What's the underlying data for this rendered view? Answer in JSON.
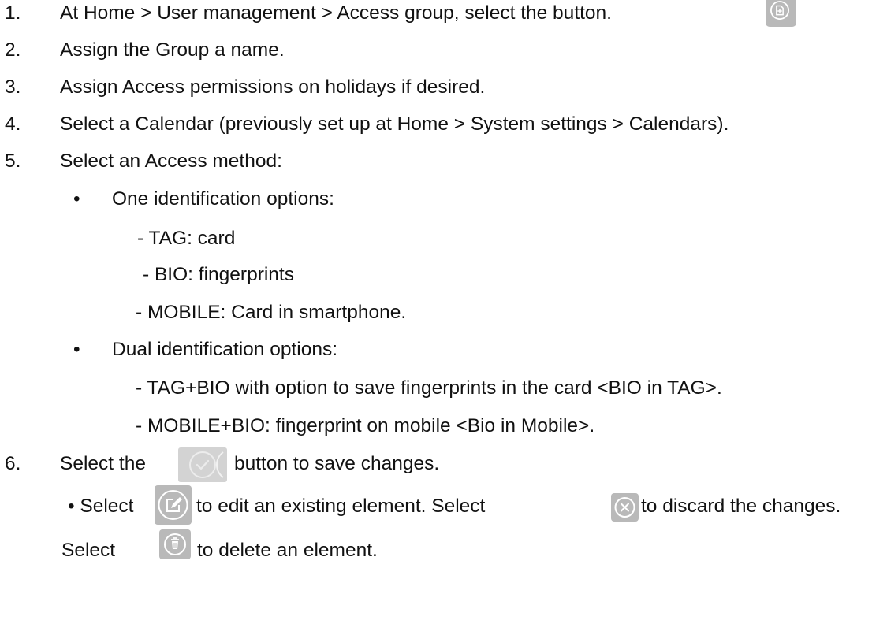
{
  "steps": [
    {
      "num": "1.",
      "text": "At Home > User management > Access group, select the button."
    },
    {
      "num": "2.",
      "text": "Assign the Group a name."
    },
    {
      "num": "3.",
      "text": "Assign Access permissions on holidays if desired."
    },
    {
      "num": "4.",
      "text": "Select a Calendar (previously set up at Home > System settings > Calendars)."
    },
    {
      "num": "5.",
      "text": "Select an Access method:"
    },
    {
      "num": "6.",
      "text_before": "Select the",
      "text_after": "button to save changes."
    }
  ],
  "access_methods": {
    "one": {
      "bullet": "•",
      "label": "One identification options:",
      "items": [
        "- TAG: card",
        "- BIO: fingerprints",
        "- MOBILE: Card in smartphone."
      ]
    },
    "dual": {
      "bullet": "•",
      "label": "Dual identification options:",
      "items": [
        "- TAG+BIO with option to save fingerprints in the card <BIO in TAG>.",
        "- MOBILE+BIO: fingerprint on mobile <Bio in Mobile>."
      ]
    }
  },
  "notes": {
    "edit_prefix": "• Select",
    "edit_text": "to edit an existing element. Select",
    "discard_text": "to discard the changes.",
    "delete_prefix": "Select",
    "delete_text": "to delete an element."
  },
  "icons": {
    "add": "add-group-icon",
    "save": "check-circle-icon",
    "edit": "edit-icon",
    "discard": "close-circle-icon",
    "delete": "trash-icon"
  },
  "colors": {
    "text": "#111111",
    "icon_bg": "#b9b9b9",
    "icon_fg": "#ffffff"
  }
}
